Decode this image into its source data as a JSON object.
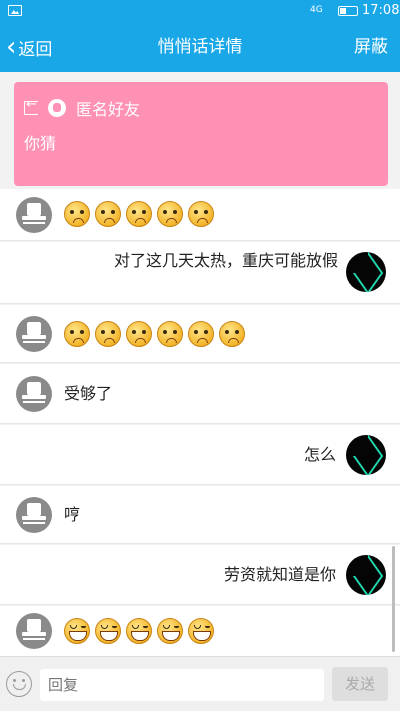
{
  "status_bar": {
    "network": "4G",
    "time": "17:08"
  },
  "header": {
    "back_label": "返回",
    "title": "悄悄话详情",
    "block_label": "屏蔽"
  },
  "card": {
    "name": "匿名好友",
    "message": "你猜"
  },
  "messages": [
    {
      "from": "anon",
      "type": "emoji",
      "emoji": "sad",
      "count": 5
    },
    {
      "from": "self",
      "type": "text",
      "text": "对了这几天太热，重庆可能放假"
    },
    {
      "from": "anon",
      "type": "emoji",
      "emoji": "sad",
      "count": 6
    },
    {
      "from": "anon",
      "type": "text",
      "text": "受够了"
    },
    {
      "from": "self",
      "type": "text",
      "text": "怎么"
    },
    {
      "from": "anon",
      "type": "text",
      "text": "哼"
    },
    {
      "from": "self",
      "type": "text",
      "text": "劳资就知道是你"
    },
    {
      "from": "anon",
      "type": "emoji",
      "emoji": "grin",
      "count": 5
    }
  ],
  "input": {
    "placeholder": "回复",
    "send_label": "发送"
  },
  "colors": {
    "header": "#1aa7e8",
    "card": "#ff91b4"
  }
}
